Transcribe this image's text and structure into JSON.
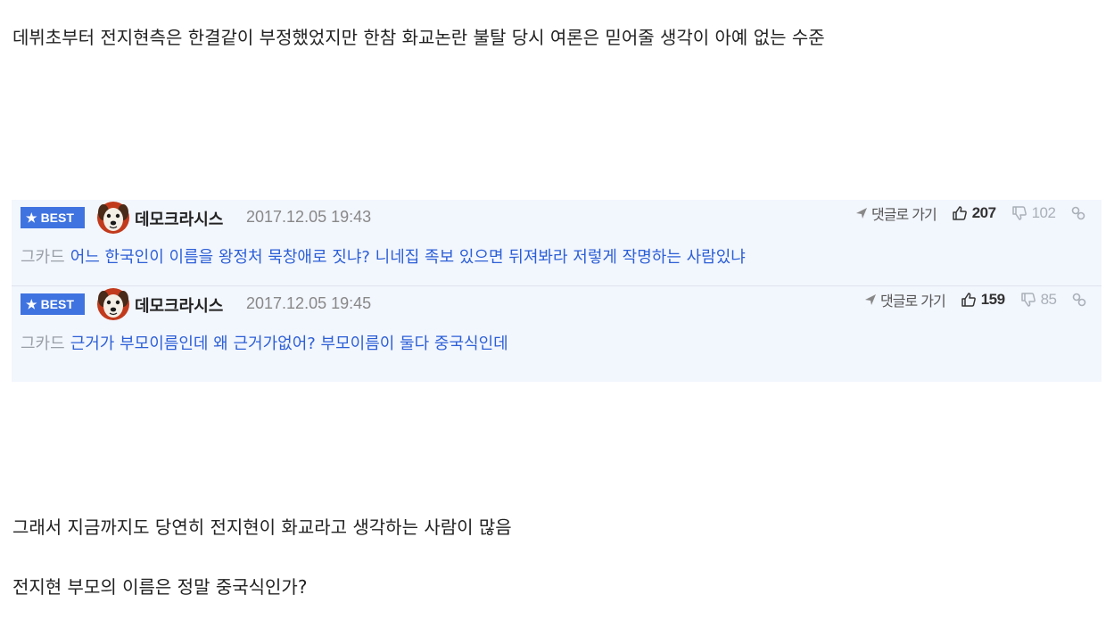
{
  "article": {
    "paragraph_1": "데뷔초부터 전지현측은 한결같이 부정했었지만 한참 화교논란 불탈 당시 여론은 믿어줄 생각이 아예 없는 수준",
    "paragraph_2": "그래서 지금까지도 당연히 전지현이 화교라고 생각하는 사람이 많음",
    "paragraph_3": "전지현 부모의 이름은 정말 중국식인가?"
  },
  "comments": [
    {
      "badge": "BEST",
      "author": "데모크라시스",
      "timestamp": "2017.12.05 19:43",
      "reply_label": "댓글로 가기",
      "upvotes": "207",
      "downvotes": "102",
      "tag": "그카드",
      "text": "어느 한국인이 이름을 왕정처 묵창애로 짓냐? 니네집 족보 있으면 뒤져봐라 저렇게 작명하는 사람있냐"
    },
    {
      "badge": "BEST",
      "author": "데모크라시스",
      "timestamp": "2017.12.05 19:45",
      "reply_label": "댓글로 가기",
      "upvotes": "159",
      "downvotes": "85",
      "tag": "그카드",
      "text": "근거가 부모이름인데 왜 근거가없어? 부모이름이 둘다 중국식인데"
    }
  ],
  "icons": {
    "badge_star": "star-icon",
    "avatar": "dog-avatar",
    "reply": "arrow-icon",
    "upvote": "thumbs-up-icon",
    "downvote": "thumbs-down-icon",
    "share": "link-icon"
  },
  "colors": {
    "badge_bg": "#3f73e0",
    "comment_link": "#2c5fd6",
    "comments_bg": "#f2f6fd"
  }
}
